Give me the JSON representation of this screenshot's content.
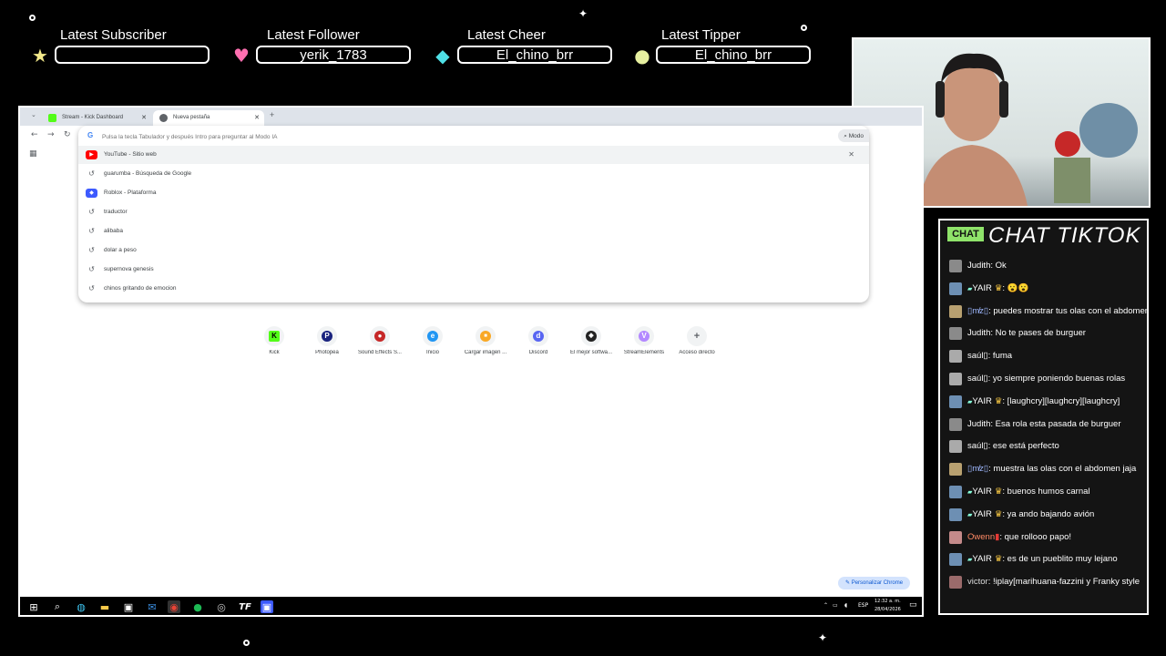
{
  "alerts": [
    {
      "label": "Latest Subscriber",
      "value": "",
      "icon": "star-icon",
      "color": "#f3e98a"
    },
    {
      "label": "Latest Follower",
      "value": "yerik_1783",
      "icon": "heart-icon",
      "color": "#ff6fb0"
    },
    {
      "label": "Latest Cheer",
      "value": "El_chino_brr",
      "icon": "gem-icon",
      "color": "#4fe0e6"
    },
    {
      "label": "Latest Tipper",
      "value": "El_chino_brr",
      "icon": "coin-icon",
      "color": "#e7f0a0"
    }
  ],
  "browser": {
    "tabs": [
      {
        "title": "Stream - Kick Dashboard",
        "active": false
      },
      {
        "title": "Nueva pestaña",
        "active": true
      }
    ],
    "omnibox_placeholder": "Pulsa la tecla Tabulador y después Intro para preguntar al Modo IA",
    "mode_button": "Modo",
    "suggestions": [
      {
        "text": "YouTube - Sitio web",
        "icon": "youtube-icon"
      },
      {
        "text": "guarumba - Búsqueda de Google",
        "icon": "history-icon"
      },
      {
        "text": "Roblox - Plataforma",
        "icon": "roblox-icon"
      },
      {
        "text": "traductor",
        "icon": "history-icon"
      },
      {
        "text": "alibaba",
        "icon": "history-icon"
      },
      {
        "text": "dolar a peso",
        "icon": "history-icon"
      },
      {
        "text": "supernova genesis",
        "icon": "history-icon"
      },
      {
        "text": "chinos gritando de emocion",
        "icon": "history-icon"
      }
    ],
    "shortcuts": [
      {
        "label": "Kick",
        "color": "#53fc18",
        "glyph": "K"
      },
      {
        "label": "Photopea",
        "color": "#1a237e",
        "glyph": "P"
      },
      {
        "label": "Sound Effects S...",
        "color": "#c62828",
        "glyph": "●"
      },
      {
        "label": "Inicio",
        "color": "#2196f3",
        "glyph": "e"
      },
      {
        "label": "Cargar imagen ...",
        "color": "#f9a825",
        "glyph": "■"
      },
      {
        "label": "Discord",
        "color": "#5865f2",
        "glyph": "d"
      },
      {
        "label": "El mejor softwa...",
        "color": "#222222",
        "glyph": "◆"
      },
      {
        "label": "StreamElements",
        "color": "#b388ff",
        "glyph": "V"
      },
      {
        "label": "Acceso directo",
        "color": "#5f6368",
        "glyph": "+"
      }
    ],
    "customize_label": "Personalizar Chrome"
  },
  "taskbar": {
    "lang": "ESP",
    "time": "12:32 a. m.",
    "date": "28/04/2026"
  },
  "chat": {
    "badge": "CHAT",
    "title": "CHAT TIKTOK",
    "messages": [
      {
        "user": "Judith",
        "text": ": Ok",
        "kind": "plain"
      },
      {
        "user": "YAIR",
        "text": ": 😮😮",
        "kind": "yair"
      },
      {
        "user": "▯m̸z▯",
        "text": ": puedes mostrar tus olas con el abdomen",
        "kind": "dm"
      },
      {
        "user": "Judith",
        "text": ": No te pases de burguer",
        "kind": "plain"
      },
      {
        "user": "saúl▯",
        "text": ": fuma",
        "kind": "plain"
      },
      {
        "user": "saúl▯",
        "text": ": yo siempre poniendo buenas rolas",
        "kind": "plain"
      },
      {
        "user": "YAIR",
        "text": ": [laughcry][laughcry][laughcry]",
        "kind": "yair"
      },
      {
        "user": "Judith",
        "text": ": Esa rola esta pasada de burguer",
        "kind": "plain"
      },
      {
        "user": "saúl▯",
        "text": ": ese está perfecto",
        "kind": "plain"
      },
      {
        "user": "▯m̸z▯",
        "text": ": muestra las olas con el abdomen jaja",
        "kind": "dm"
      },
      {
        "user": "YAIR",
        "text": ": buenos humos carnal",
        "kind": "yair"
      },
      {
        "user": "YAIR",
        "text": ": ya ando bajando avión",
        "kind": "yair"
      },
      {
        "user": "Owenn",
        "text": ": que rollooo papo!",
        "kind": "owen"
      },
      {
        "user": "YAIR",
        "text": ": es de un pueblito muy lejano",
        "kind": "yair"
      },
      {
        "user": "victor",
        "text": ": !iplay[marihuana-fazzini y Franky style",
        "kind": "vic"
      }
    ]
  }
}
